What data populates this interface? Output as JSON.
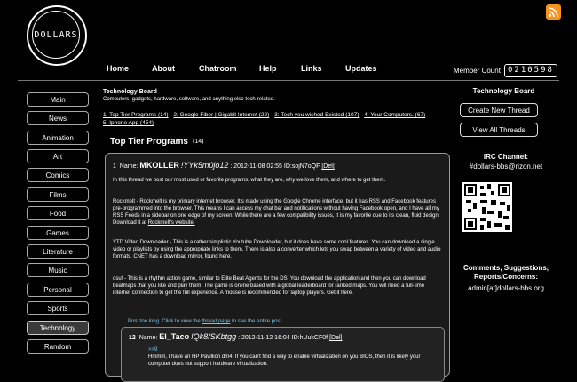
{
  "logo": {
    "text": "DOLLARS"
  },
  "nav": {
    "items": [
      "Home",
      "About",
      "Chatroom",
      "Help",
      "Links",
      "Updates"
    ],
    "member_label": "Member Count",
    "member_count": "0210598"
  },
  "sidebar": {
    "items": [
      "Main",
      "News",
      "Animation",
      "Art",
      "Comics",
      "Films",
      "Food",
      "Games",
      "Literature",
      "Music",
      "Personal",
      "Sports",
      "Technology",
      "Random"
    ],
    "active": "Technology"
  },
  "board": {
    "title": "Technology Board",
    "description": "Computers, gadgets, hardware, software, and anything else tech-related.",
    "threads": [
      "1: Top Tier Programs (14)",
      "2: Google Fiber | Gigabit Internet (22)",
      "3: Tech you wished Existed (107)",
      "4: Your Computers. (67)",
      "5: Iphone App (454)"
    ]
  },
  "thread": {
    "title": "Top Tier Programs",
    "count": "(14)"
  },
  "post": {
    "number": "1",
    "name_label": "Name:",
    "name": "MKOLLER",
    "tripcode": "!YYk5m0jo12",
    "meta": ": 2012-11-08 02:55 ID:sojN7oQF",
    "del": "[Del]",
    "p1": "In this thread we post our most used or favorite programs, what they are, why we love them, and where to get them.",
    "p2": "Rockmelt - Rockmelt is my primary internet browser. It's made using the Google Chrome interface, but it has RSS and Facebook features pre-programmed into the browser. This means I can access my chat bar and notifications without having Facebook open, and I have all my RSS Feeds in a sidebar on one edge of my screen. While there are a few compatibility issues, it is my favorite due to its clean, fluid design. Download it at",
    "p2_link": "Rockmelt's website.",
    "p3": "YTD Video Downloader - This is a rather simplistic Youtube Downloader, but it does have some cool features. You can download a single video or playlists by using the appropriate links to them. There is also a converter which lets you swap between a variety of video and audio formats.",
    "p3_link": "CNET has a download mirror, found here.",
    "p4": "osu! - This is a rhythm action game, similar to Elite Beat Agents for the DS. You download the application and then you can download beatmaps that you like and play them. The game is online based with a global leaderboard for ranked maps. You will need a full-time internet connection to get the full experience. A mouse is recommended for laptop players. Get it here.",
    "too_long": "Post too long. Click to view the",
    "too_long_link": "thread page",
    "too_long_end": "to see the entire post."
  },
  "reply": {
    "number": "12",
    "name_label": "Name:",
    "name": "El_Taco",
    "tripcode": "!Qk8/SKbtgg",
    "meta": ": 2012-11-12 16:04 ID:hUukCF0f",
    "del": "[Del]",
    "quote": ">>9",
    "text": "Hmmm, I have an HP Pavillion dm4. If you can't find a way to enable virtualization on you BIOS, then it is likely your computer does not support hardware virtualization."
  },
  "right": {
    "title": "Technology Board",
    "create_btn": "Create New Thread",
    "view_btn": "View All Threads",
    "irc_label": "IRC Channel:",
    "irc_value": "#dollars-bbs@rizon.net",
    "contact_label": "Comments, Suggestions, Reports/Concerns:",
    "contact_value": "admin[at]dollars-bbs.org"
  },
  "colors": {
    "accent": "#7ac8e8",
    "rss": "#f7931e",
    "background": "#000000"
  }
}
